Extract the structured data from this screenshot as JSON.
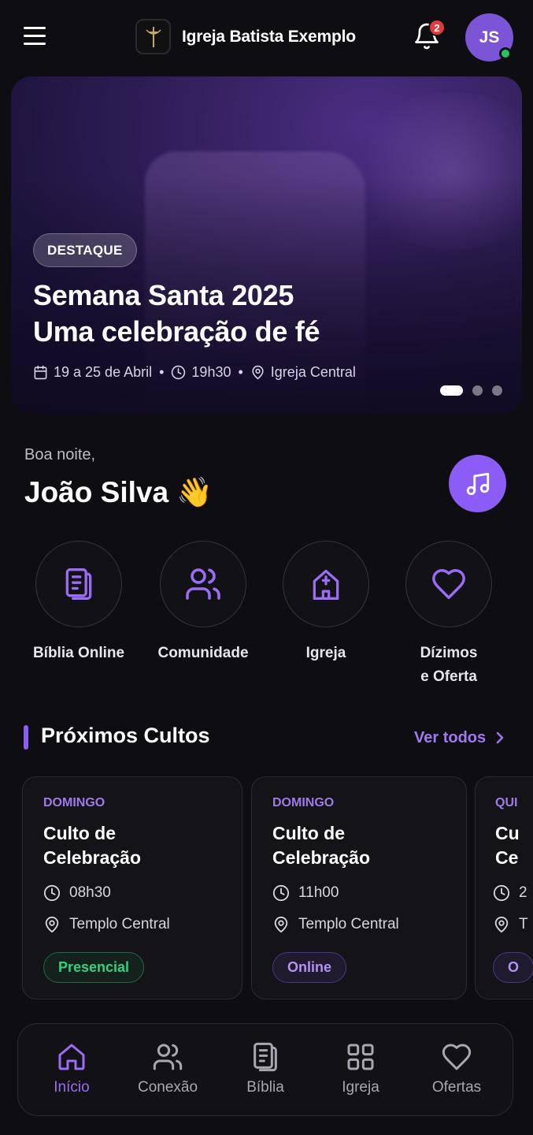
{
  "header": {
    "app_title": "Igreja Batista Exemplo",
    "notification_count": "2",
    "user_initials": "JS"
  },
  "hero": {
    "badge": "DESTAQUE",
    "title_line1": "Semana Santa 2025",
    "title_line2": "Uma celebração de fé",
    "date": "19 a 25 de Abril",
    "time": "19h30",
    "location": "Igreja Central",
    "separator": "•",
    "slide_count": 3,
    "active_slide": 1
  },
  "greeting": {
    "salutation": "Boa noite,",
    "name": "João Silva",
    "emoji": "👋"
  },
  "quick_actions": [
    {
      "label_line1": "Bíblia Online",
      "label_line2": "",
      "icon": "bible-icon"
    },
    {
      "label_line1": "Comunidade",
      "label_line2": "",
      "icon": "users-icon"
    },
    {
      "label_line1": "Igreja",
      "label_line2": "",
      "icon": "church-icon"
    },
    {
      "label_line1": "Dízimos",
      "label_line2": "e Oferta",
      "icon": "heart-icon"
    }
  ],
  "services_section": {
    "title": "Próximos Cultos",
    "see_all": "Ver todos"
  },
  "services": [
    {
      "day": "DOMINGO",
      "title_line1": "Culto de",
      "title_line2": "Celebração",
      "time": "08h30",
      "place": "Templo Central",
      "mode": "Presencial"
    },
    {
      "day": "DOMINGO",
      "title_line1": "Culto de",
      "title_line2": "Celebração",
      "time": "11h00",
      "place": "Templo Central",
      "mode": "Online"
    },
    {
      "day": "QUI",
      "title_line1": "Cu",
      "title_line2": "Ce",
      "time": "2",
      "place": "T",
      "mode": "O"
    }
  ],
  "bottom_nav": [
    {
      "label": "Início",
      "icon": "home-icon",
      "active": true
    },
    {
      "label": "Conexão",
      "icon": "users-icon",
      "active": false
    },
    {
      "label": "Bíblia",
      "icon": "bible-icon",
      "active": false
    },
    {
      "label": "Igreja",
      "icon": "grid-icon",
      "active": false
    },
    {
      "label": "Ofertas",
      "icon": "heart-icon",
      "active": false
    }
  ],
  "colors": {
    "background": "#0e0e12",
    "accent": "#8b5cf6",
    "notification": "#e23b3b",
    "online": "#22c55e",
    "presencial": "#34d17c"
  }
}
